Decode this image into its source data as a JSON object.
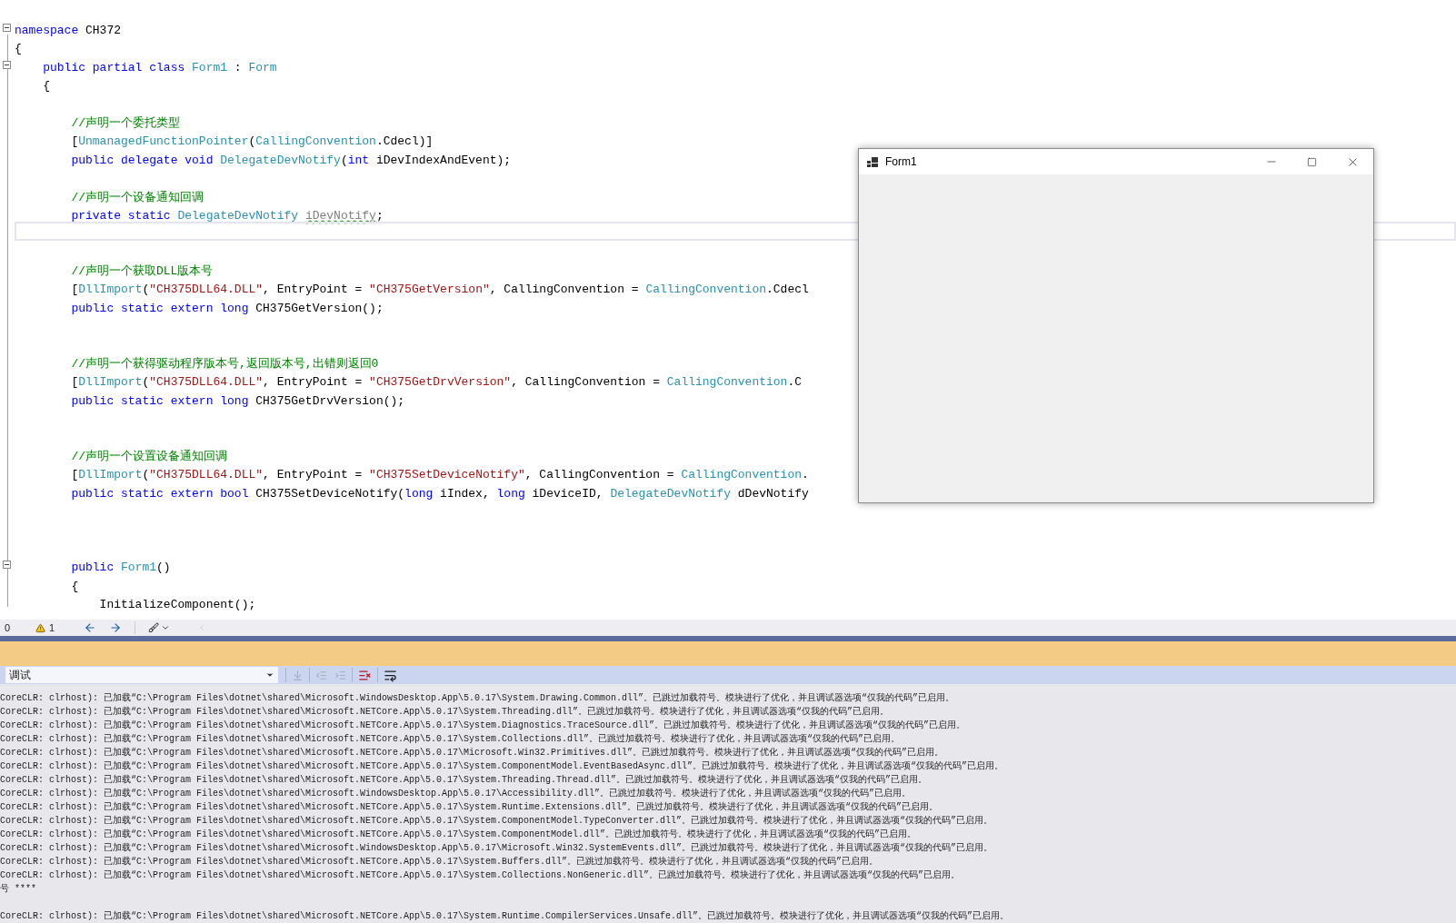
{
  "editor": {
    "lines": [
      {
        "kind": "code",
        "foldable": true,
        "tokens": [
          {
            "kind": "kw",
            "text": "namespace"
          },
          {
            "kind": "plain",
            "text": " CH372"
          }
        ]
      },
      {
        "kind": "code",
        "tokens": [
          {
            "kind": "plain",
            "text": "{"
          }
        ]
      },
      {
        "kind": "code",
        "foldable": true,
        "tokens": [
          {
            "kind": "kw",
            "text": "    public partial class "
          },
          {
            "kind": "type",
            "text": "Form1"
          },
          {
            "kind": "plain",
            "text": " : "
          },
          {
            "kind": "type",
            "text": "Form"
          }
        ]
      },
      {
        "kind": "code",
        "tokens": [
          {
            "kind": "plain",
            "text": "    {"
          }
        ]
      },
      {
        "kind": "blank"
      },
      {
        "kind": "code",
        "tokens": [
          {
            "kind": "cmt",
            "text": "        //声明一个委托类型"
          }
        ]
      },
      {
        "kind": "code",
        "tokens": [
          {
            "kind": "plain",
            "text": "        ["
          },
          {
            "kind": "type",
            "text": "UnmanagedFunctionPointer"
          },
          {
            "kind": "plain",
            "text": "("
          },
          {
            "kind": "type",
            "text": "CallingConvention"
          },
          {
            "kind": "plain",
            "text": ".Cdecl)]"
          }
        ]
      },
      {
        "kind": "code",
        "tokens": [
          {
            "kind": "kw",
            "text": "        public delegate void "
          },
          {
            "kind": "type",
            "text": "DelegateDevNotify"
          },
          {
            "kind": "plain",
            "text": "("
          },
          {
            "kind": "kw",
            "text": "int"
          },
          {
            "kind": "plain",
            "text": " iDevIndexAndEvent);"
          }
        ]
      },
      {
        "kind": "blank"
      },
      {
        "kind": "code",
        "tokens": [
          {
            "kind": "cmt",
            "text": "        //声明一个设备通知回调"
          }
        ]
      },
      {
        "kind": "code",
        "tokens": [
          {
            "kind": "kw",
            "text": "        private static "
          },
          {
            "kind": "type",
            "text": "DelegateDevNotify "
          },
          {
            "kind": "squiggle",
            "text": "iDevNotify"
          },
          {
            "kind": "plain",
            "text": ";"
          }
        ]
      },
      {
        "kind": "blank",
        "current": true
      },
      {
        "kind": "blank"
      },
      {
        "kind": "code",
        "tokens": [
          {
            "kind": "cmt",
            "text": "        //声明一个获取DLL版本号"
          }
        ]
      },
      {
        "kind": "code",
        "tokens": [
          {
            "kind": "plain",
            "text": "        ["
          },
          {
            "kind": "type",
            "text": "DllImport"
          },
          {
            "kind": "plain",
            "text": "("
          },
          {
            "kind": "str",
            "text": "\"CH375DLL64.DLL\""
          },
          {
            "kind": "plain",
            "text": ", EntryPoint = "
          },
          {
            "kind": "str",
            "text": "\"CH375GetVersion\""
          },
          {
            "kind": "plain",
            "text": ", CallingConvention = "
          },
          {
            "kind": "type",
            "text": "CallingConvention"
          },
          {
            "kind": "plain",
            "text": ".Cdecl"
          }
        ]
      },
      {
        "kind": "code",
        "tokens": [
          {
            "kind": "kw",
            "text": "        public static extern long"
          },
          {
            "kind": "plain",
            "text": " CH375GetVersion();"
          }
        ]
      },
      {
        "kind": "blank"
      },
      {
        "kind": "blank"
      },
      {
        "kind": "code",
        "tokens": [
          {
            "kind": "cmt",
            "text": "        //声明一个获得驱动程序版本号,返回版本号,出错则返回0"
          }
        ]
      },
      {
        "kind": "code",
        "tokens": [
          {
            "kind": "plain",
            "text": "        ["
          },
          {
            "kind": "type",
            "text": "DllImport"
          },
          {
            "kind": "plain",
            "text": "("
          },
          {
            "kind": "str",
            "text": "\"CH375DLL64.DLL\""
          },
          {
            "kind": "plain",
            "text": ", EntryPoint = "
          },
          {
            "kind": "str",
            "text": "\"CH375GetDrvVersion\""
          },
          {
            "kind": "plain",
            "text": ", CallingConvention = "
          },
          {
            "kind": "type",
            "text": "CallingConvention"
          },
          {
            "kind": "plain",
            "text": ".C"
          }
        ]
      },
      {
        "kind": "code",
        "tokens": [
          {
            "kind": "kw",
            "text": "        public static extern long"
          },
          {
            "kind": "plain",
            "text": " CH375GetDrvVersion();"
          }
        ]
      },
      {
        "kind": "blank"
      },
      {
        "kind": "blank"
      },
      {
        "kind": "code",
        "tokens": [
          {
            "kind": "cmt",
            "text": "        //声明一个设置设备通知回调"
          }
        ]
      },
      {
        "kind": "code",
        "tokens": [
          {
            "kind": "plain",
            "text": "        ["
          },
          {
            "kind": "type",
            "text": "DllImport"
          },
          {
            "kind": "plain",
            "text": "("
          },
          {
            "kind": "str",
            "text": "\"CH375DLL64.DLL\""
          },
          {
            "kind": "plain",
            "text": ", EntryPoint = "
          },
          {
            "kind": "str",
            "text": "\"CH375SetDeviceNotify\""
          },
          {
            "kind": "plain",
            "text": ", CallingConvention = "
          },
          {
            "kind": "type",
            "text": "CallingConvention"
          },
          {
            "kind": "plain",
            "text": "."
          }
        ]
      },
      {
        "kind": "code",
        "tokens": [
          {
            "kind": "kw",
            "text": "        public static extern bool"
          },
          {
            "kind": "plain",
            "text": " CH375SetDeviceNotify("
          },
          {
            "kind": "kw",
            "text": "long"
          },
          {
            "kind": "plain",
            "text": " iIndex, "
          },
          {
            "kind": "kw",
            "text": "long"
          },
          {
            "kind": "plain",
            "text": " iDeviceID, "
          },
          {
            "kind": "type",
            "text": "DelegateDevNotify"
          },
          {
            "kind": "plain",
            "text": " dDevNotify"
          }
        ]
      },
      {
        "kind": "blank"
      },
      {
        "kind": "blank"
      },
      {
        "kind": "blank"
      },
      {
        "kind": "code",
        "foldable": true,
        "tokens": [
          {
            "kind": "kw",
            "text": "        public "
          },
          {
            "kind": "type",
            "text": "Form1"
          },
          {
            "kind": "plain",
            "text": "()"
          }
        ]
      },
      {
        "kind": "code",
        "tokens": [
          {
            "kind": "plain",
            "text": "        {"
          }
        ]
      },
      {
        "kind": "code",
        "tokens": [
          {
            "kind": "plain",
            "text": "            InitializeComponent();"
          }
        ]
      }
    ]
  },
  "form_window": {
    "title": "Form1"
  },
  "status_bar": {
    "errors": "0",
    "warnings": "1"
  },
  "output": {
    "source": "调试",
    "lines": [
      {
        "text": "CoreCLR: clrhost): 已加载“C:\\Program Files\\dotnet\\shared\\Microsoft.WindowsDesktop.App\\5.0.17\\System.Drawing.Common.dll”。已跳过加载符号。模块进行了优化，并且调试器选项“仅我的代码”已启用。"
      },
      {
        "text": "CoreCLR: clrhost): 已加载“C:\\Program Files\\dotnet\\shared\\Microsoft.NETCore.App\\5.0.17\\System.Threading.dll”。已跳过加载符号。模块进行了优化，并且调试器选项“仅我的代码”已启用。"
      },
      {
        "text": "CoreCLR: clrhost): 已加载“C:\\Program Files\\dotnet\\shared\\Microsoft.NETCore.App\\5.0.17\\System.Diagnostics.TraceSource.dll”。已跳过加载符号。模块进行了优化，并且调试器选项“仅我的代码”已启用。"
      },
      {
        "text": "CoreCLR: clrhost): 已加载“C:\\Program Files\\dotnet\\shared\\Microsoft.NETCore.App\\5.0.17\\System.Collections.dll”。已跳过加载符号。模块进行了优化，并且调试器选项“仅我的代码”已启用。"
      },
      {
        "text": "CoreCLR: clrhost): 已加载“C:\\Program Files\\dotnet\\shared\\Microsoft.NETCore.App\\5.0.17\\Microsoft.Win32.Primitives.dll”。已跳过加载符号。模块进行了优化，并且调试器选项“仅我的代码”已启用。"
      },
      {
        "text": "CoreCLR: clrhost): 已加载“C:\\Program Files\\dotnet\\shared\\Microsoft.NETCore.App\\5.0.17\\System.ComponentModel.EventBasedAsync.dll”。已跳过加载符号。模块进行了优化，并且调试器选项“仅我的代码”已启用。"
      },
      {
        "text": "CoreCLR: clrhost): 已加载“C:\\Program Files\\dotnet\\shared\\Microsoft.NETCore.App\\5.0.17\\System.Threading.Thread.dll”。已跳过加载符号。模块进行了优化，并且调试器选项“仅我的代码”已启用。"
      },
      {
        "text": "CoreCLR: clrhost): 已加载“C:\\Program Files\\dotnet\\shared\\Microsoft.WindowsDesktop.App\\5.0.17\\Accessibility.dll”。已跳过加载符号。模块进行了优化，并且调试器选项“仅我的代码”已启用。"
      },
      {
        "text": "CoreCLR: clrhost): 已加载“C:\\Program Files\\dotnet\\shared\\Microsoft.NETCore.App\\5.0.17\\System.Runtime.Extensions.dll”。已跳过加载符号。模块进行了优化，并且调试器选项“仅我的代码”已启用。"
      },
      {
        "text": "CoreCLR: clrhost): 已加载“C:\\Program Files\\dotnet\\shared\\Microsoft.NETCore.App\\5.0.17\\System.ComponentModel.TypeConverter.dll”。已跳过加载符号。模块进行了优化，并且调试器选项“仅我的代码”已启用。"
      },
      {
        "text": "CoreCLR: clrhost): 已加载“C:\\Program Files\\dotnet\\shared\\Microsoft.NETCore.App\\5.0.17\\System.ComponentModel.dll”。已跳过加载符号。模块进行了优化，并且调试器选项“仅我的代码”已启用。"
      },
      {
        "text": "CoreCLR: clrhost): 已加载“C:\\Program Files\\dotnet\\shared\\Microsoft.WindowsDesktop.App\\5.0.17\\Microsoft.Win32.SystemEvents.dll”。已跳过加载符号。模块进行了优化，并且调试器选项“仅我的代码”已启用。"
      },
      {
        "text": "CoreCLR: clrhost): 已加载“C:\\Program Files\\dotnet\\shared\\Microsoft.NETCore.App\\5.0.17\\System.Buffers.dll”。已跳过加载符号。模块进行了优化，并且调试器选项“仅我的代码”已启用。"
      },
      {
        "text": "CoreCLR: clrhost): 已加载“C:\\Program Files\\dotnet\\shared\\Microsoft.NETCore.App\\5.0.17\\System.Collections.NonGeneric.dll”。已跳过加载符号。模块进行了优化，并且调试器选项“仅我的代码”已启用。"
      },
      {
        "text": "号 ****"
      },
      {
        "text": "CoreCLR: clrhost): 已加载“C:\\Program Files\\dotnet\\shared\\Microsoft.NETCore.App\\5.0.17\\System.Runtime.CompilerServices.Unsafe.dll”。已跳过加载符号。模块进行了优化，并且调试器选项“仅我的代码”已启用。",
        "gap_before": true
      }
    ]
  }
}
